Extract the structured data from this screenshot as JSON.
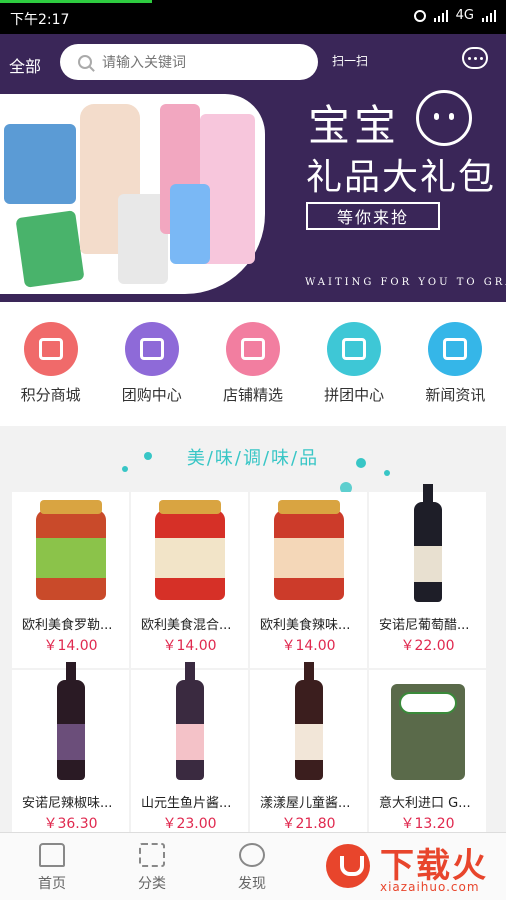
{
  "status": {
    "time": "下午2:17",
    "network": "4G"
  },
  "header": {
    "all_label": "全部",
    "search_placeholder": "请输入关键词",
    "scan_label": "扫一扫"
  },
  "banner": {
    "line1": "宝宝",
    "line2": "礼品大礼包",
    "cta": "等你来抢",
    "english": "WAITING FOR YOU TO GRAB"
  },
  "menu": [
    {
      "label": "积分商城",
      "color": "#f06a6a",
      "icon": "gift-icon"
    },
    {
      "label": "团购中心",
      "color": "#8e6ad8",
      "icon": "group-icon"
    },
    {
      "label": "店铺精选",
      "color": "#f27ea0",
      "icon": "store-icon"
    },
    {
      "label": "拼团中心",
      "color": "#3ec7d6",
      "icon": "puzzle-icon"
    },
    {
      "label": "新闻资讯",
      "color": "#35b6e8",
      "icon": "flame-icon"
    }
  ],
  "section": {
    "title": "美/味/调/味/品"
  },
  "products": [
    {
      "name": "欧利美食罗勒...",
      "price": "￥14.00",
      "kind": "jar",
      "color": "#c94a2a",
      "label": "#8bc34a"
    },
    {
      "name": "欧利美食混合...",
      "price": "￥14.00",
      "kind": "jar",
      "color": "#d63027",
      "label": "#f2e4c8"
    },
    {
      "name": "欧利美食辣味...",
      "price": "￥14.00",
      "kind": "jar",
      "color": "#cc3b2a",
      "label": "#f4d7b8"
    },
    {
      "name": "安诺尼葡萄醋...",
      "price": "￥22.00",
      "kind": "bottle",
      "color": "#1e1e28",
      "label": "#e8e0d0"
    },
    {
      "name": "安诺尼辣椒味...",
      "price": "￥36.30",
      "kind": "bottle",
      "color": "#2a1a24",
      "label": "#6b4e7a"
    },
    {
      "name": "山元生鱼片酱...",
      "price": "￥23.00",
      "kind": "bottle",
      "color": "#3a2a40",
      "label": "#f4c2c8"
    },
    {
      "name": "漾漾屋儿童酱...",
      "price": "￥21.80",
      "kind": "bottle",
      "color": "#3b1e1e",
      "label": "#f2e6d8"
    },
    {
      "name": "意大利进口 G...",
      "price": "￥13.20",
      "kind": "tub",
      "color": "#5a6a4a",
      "label": "#3a8a3a"
    }
  ],
  "tabs": [
    {
      "label": "首页"
    },
    {
      "label": "分类"
    },
    {
      "label": "发现"
    }
  ],
  "watermark": {
    "text": "下载火",
    "sub": "xiazaihuo.com"
  }
}
